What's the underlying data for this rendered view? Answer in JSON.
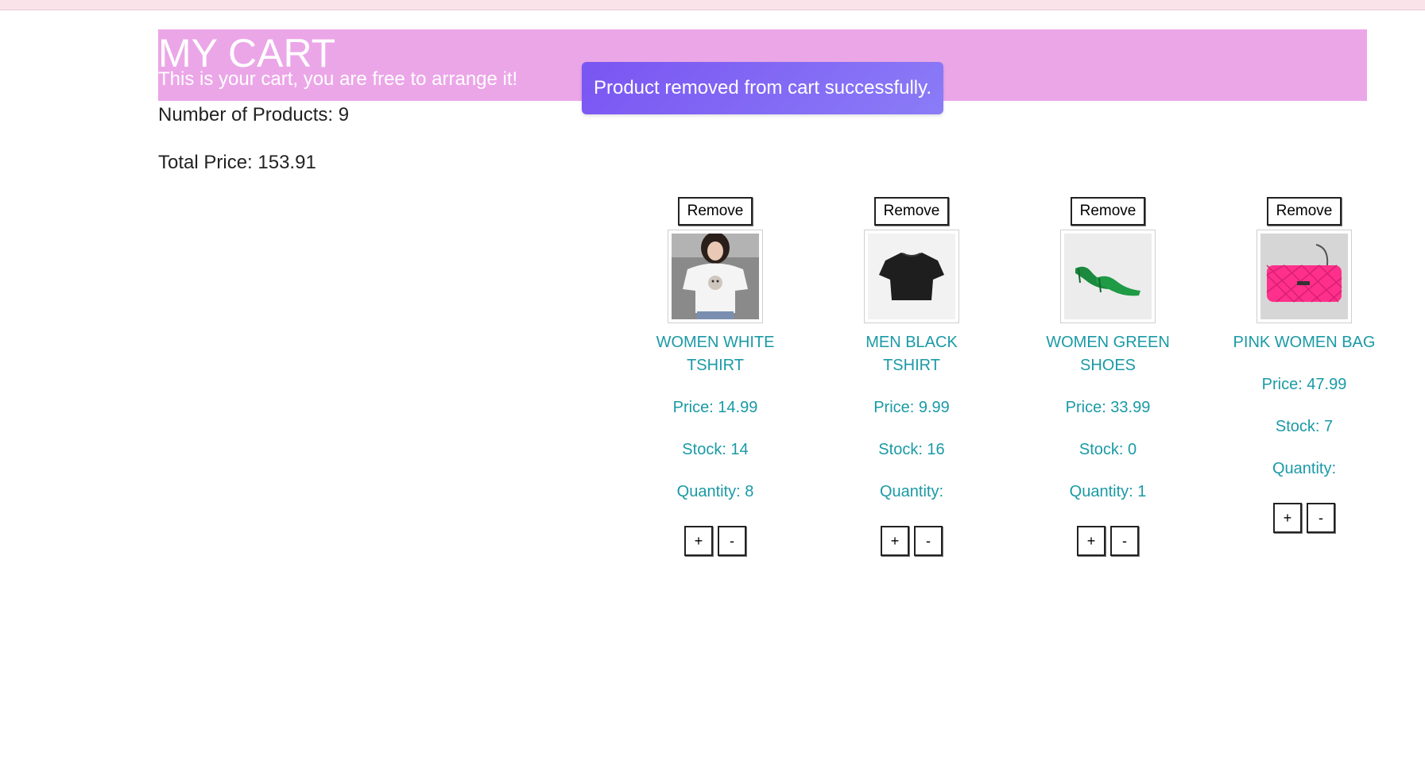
{
  "hero": {
    "title": "MY CART",
    "subtitle": "This is your cart, you are free to arrange it!"
  },
  "toast": {
    "message": "Product removed from cart successfully."
  },
  "summary": {
    "products_text": "Number of Products: 9",
    "price_text": "Total Price: 153.91"
  },
  "products": [
    {
      "remove_label": "Remove",
      "name": "WOMEN WHITE TSHIRT",
      "price_text": "Price: 14.99",
      "stock_text": "Stock: 14",
      "quantity_text": "Quantity: 8",
      "plus_label": "+",
      "minus_label": "-",
      "image_icon": "women-white-tshirt-image"
    },
    {
      "remove_label": "Remove",
      "name": "MEN BLACK TSHIRT",
      "price_text": "Price: 9.99",
      "stock_text": "Stock: 16",
      "quantity_text": "Quantity:",
      "plus_label": "+",
      "minus_label": "-",
      "image_icon": "men-black-tshirt-image"
    },
    {
      "remove_label": "Remove",
      "name": "WOMEN GREEN SHOES",
      "price_text": "Price: 33.99",
      "stock_text": "Stock: 0",
      "quantity_text": "Quantity: 1",
      "plus_label": "+",
      "minus_label": "-",
      "image_icon": "women-green-shoes-image"
    },
    {
      "remove_label": "Remove",
      "name": "PINK WOMEN BAG",
      "price_text": "Price: 47.99",
      "stock_text": "Stock: 7",
      "quantity_text": "Quantity:",
      "plus_label": "+",
      "minus_label": "-",
      "image_icon": "pink-women-bag-image"
    }
  ],
  "colors": {
    "hero_bg": "#eba6e8",
    "toast_bg": "#7a55f2",
    "product_text": "#1a9aa6"
  }
}
